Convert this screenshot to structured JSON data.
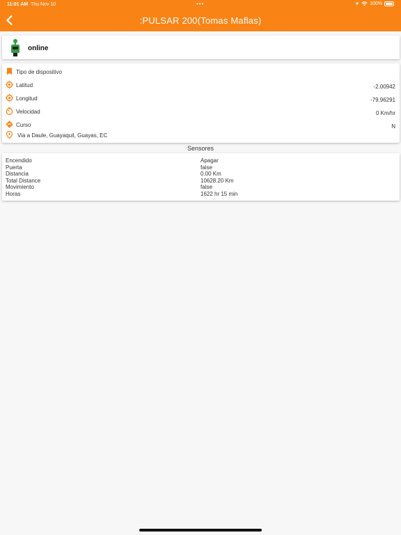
{
  "status_bar": {
    "time": "11:01 AM",
    "date": "Thu Nov 10",
    "dots": "•••",
    "battery": "100%"
  },
  "header": {
    "title": ":PULSAR 200(Tomas Maflas)",
    "back_icon": "chevron-left-icon",
    "color": "#f98314"
  },
  "device": {
    "status": "online",
    "icon": "gps-tracker-icon"
  },
  "info": {
    "device_type_label": "Tipo de dispositivo",
    "latitude_label": "Latitud",
    "latitude_value": "-2.00942",
    "longitude_label": "Longitud",
    "longitude_value": "-79.96291",
    "speed_label": "Velocidad",
    "speed_value": "0 Km/hr",
    "course_label": "Curso",
    "course_value": "N",
    "address": "Via a Daule, Guayaquil, Guayas, EC"
  },
  "sensors": {
    "title": "Sensores",
    "rows": [
      {
        "name": "Encendido",
        "value": "Apagar"
      },
      {
        "name": "Puerta",
        "value": "false"
      },
      {
        "name": "Distancia",
        "value": "0.00 Km"
      },
      {
        "name": "Total Distance",
        "value": "10628.20 Km"
      },
      {
        "name": "Movimiento",
        "value": "false"
      },
      {
        "name": "Horas",
        "value": "1622 hr 15 min"
      }
    ]
  }
}
